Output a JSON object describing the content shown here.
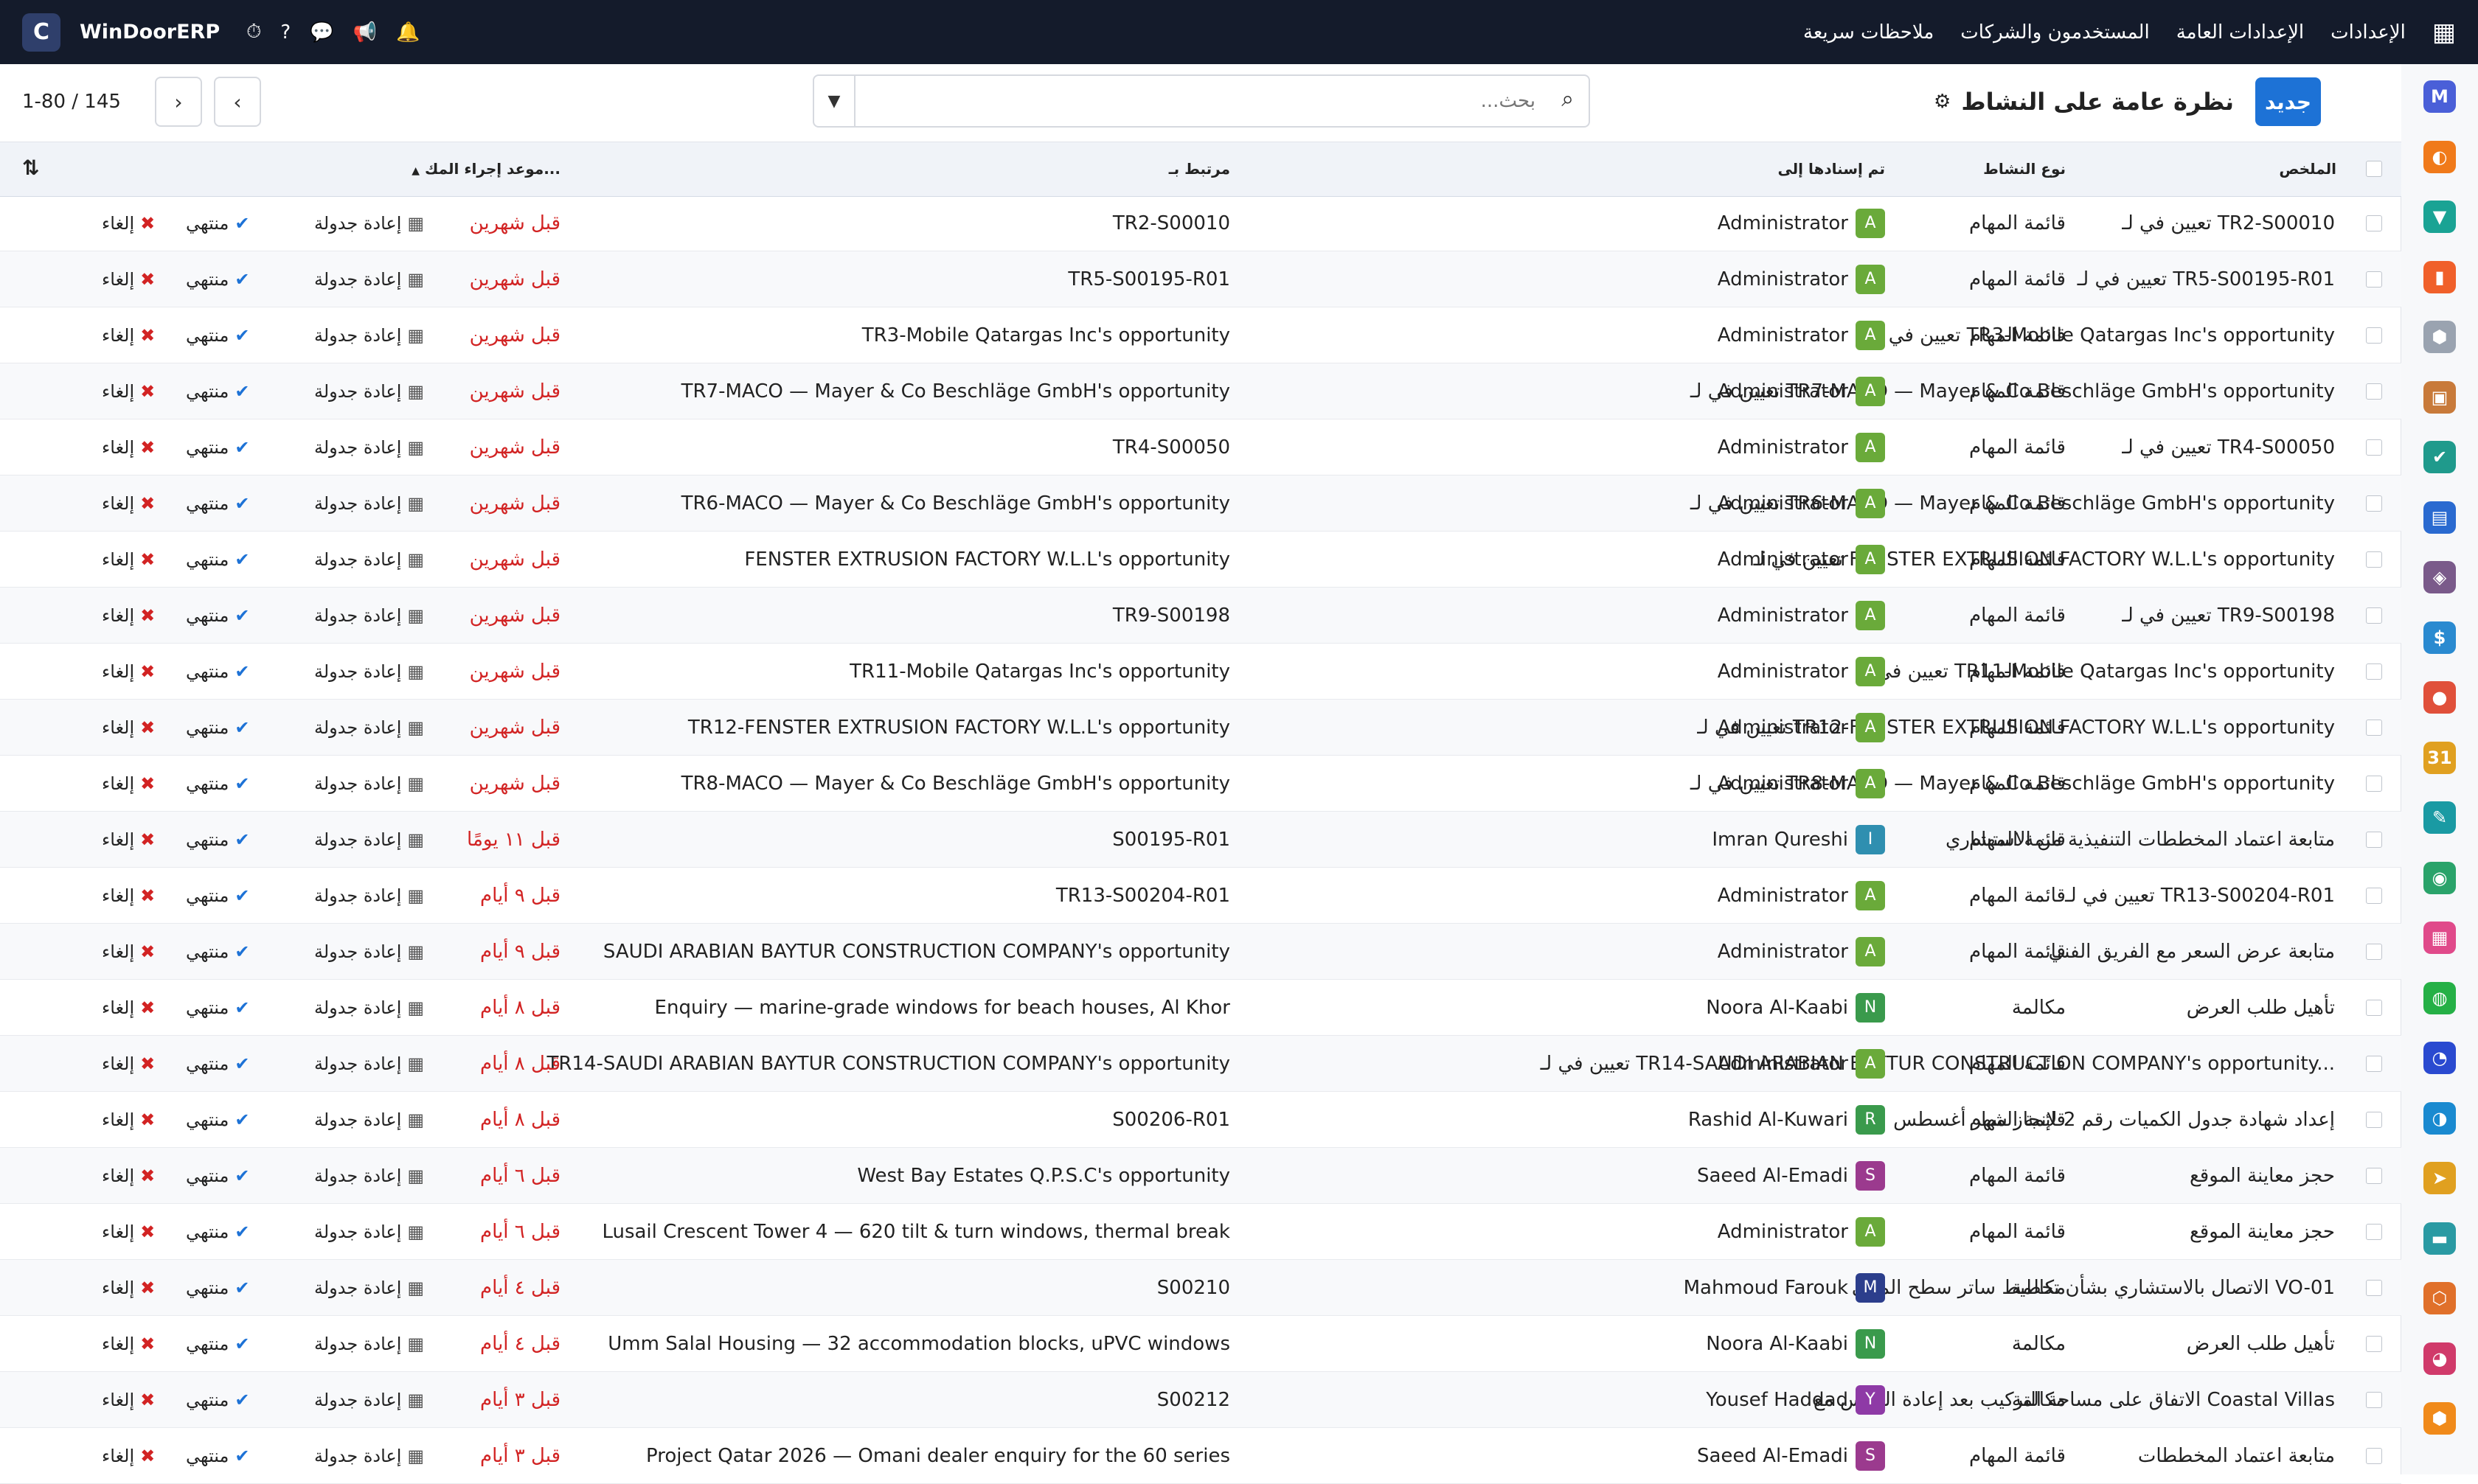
{
  "topbar": {
    "logo_letter": "C",
    "app_name": "WinDoorERP",
    "menus": [
      "الإعدادات",
      "الإعدادات العامة",
      "المستخدمون والشركات",
      "ملاحظات سريعة"
    ]
  },
  "control_panel": {
    "new_button": "جديد",
    "title": "نظرة عامة على النشاط",
    "search_placeholder": "بحث...",
    "pager": "1-80 / 145"
  },
  "table": {
    "headers": {
      "summary": "الملخص",
      "type": "نوع النشاط",
      "assigned": "تم إسنادها إلى",
      "related": "مرتبط بـ",
      "due": "موعد إجراء المك..."
    },
    "actions": {
      "reschedule": "إعادة جدولة",
      "done": "منتهي",
      "cancel": "إلغاء"
    },
    "rows": [
      {
        "summary": "تعيين في لـ TR2-S00010",
        "type": "قائمة المهام",
        "assignee": "Administrator",
        "initial": "A",
        "avatar_color": "#6aaa3a",
        "related": "TR2-S00010",
        "due": "قبل شهرين"
      },
      {
        "summary": "تعيين في لـ TR5-S00195-R01",
        "type": "قائمة المهام",
        "assignee": "Administrator",
        "initial": "A",
        "avatar_color": "#6aaa3a",
        "related": "TR5-S00195-R01",
        "due": "قبل شهرين"
      },
      {
        "summary": "تعيين في لـ TR3-Mobile Qatargas Inc's opportunity",
        "type": "قائمة المهام",
        "assignee": "Administrator",
        "initial": "A",
        "avatar_color": "#6aaa3a",
        "related": "TR3-Mobile Qatargas Inc's opportunity",
        "due": "قبل شهرين"
      },
      {
        "summary": "تعيين في لـ TR7-MACO — Mayer & Co Beschläge GmbH's opportunity",
        "type": "قائمة المهام",
        "assignee": "Administrator",
        "initial": "A",
        "avatar_color": "#6aaa3a",
        "related": "TR7-MACO — Mayer & Co Beschläge GmbH's opportunity",
        "due": "قبل شهرين"
      },
      {
        "summary": "تعيين في لـ TR4-S00050",
        "type": "قائمة المهام",
        "assignee": "Administrator",
        "initial": "A",
        "avatar_color": "#6aaa3a",
        "related": "TR4-S00050",
        "due": "قبل شهرين"
      },
      {
        "summary": "تعيين في لـ TR6-MACO — Mayer & Co Beschläge GmbH's opportunity",
        "type": "قائمة المهام",
        "assignee": "Administrator",
        "initial": "A",
        "avatar_color": "#6aaa3a",
        "related": "TR6-MACO — Mayer & Co Beschläge GmbH's opportunity",
        "due": "قبل شهرين"
      },
      {
        "summary": "تعيين في لـ FENSTER EXTRUSION FACTORY W.L.L's opportunity",
        "type": "قائمة المهام",
        "assignee": "Administrator",
        "initial": "A",
        "avatar_color": "#6aaa3a",
        "related": "FENSTER EXTRUSION FACTORY W.L.L's opportunity",
        "due": "قبل شهرين"
      },
      {
        "summary": "تعيين في لـ TR9-S00198",
        "type": "قائمة المهام",
        "assignee": "Administrator",
        "initial": "A",
        "avatar_color": "#6aaa3a",
        "related": "TR9-S00198",
        "due": "قبل شهرين"
      },
      {
        "summary": "تعيين في لـ TR11-Mobile Qatargas Inc's opportunity",
        "type": "قائمة المهام",
        "assignee": "Administrator",
        "initial": "A",
        "avatar_color": "#6aaa3a",
        "related": "TR11-Mobile Qatargas Inc's opportunity",
        "due": "قبل شهرين"
      },
      {
        "summary": "تعيين في لـ TR12-FENSTER EXTRUSION FACTORY W.L.L's opportunity",
        "type": "قائمة المهام",
        "assignee": "Administrator",
        "initial": "A",
        "avatar_color": "#6aaa3a",
        "related": "TR12-FENSTER EXTRUSION FACTORY W.L.L's opportunity",
        "due": "قبل شهرين"
      },
      {
        "summary": "تعيين في لـ TR8-MACO — Mayer & Co Beschläge GmbH's opportunity",
        "type": "قائمة المهام",
        "assignee": "Administrator",
        "initial": "A",
        "avatar_color": "#6aaa3a",
        "related": "TR8-MACO — Mayer & Co Beschläge GmbH's opportunity",
        "due": "قبل شهرين"
      },
      {
        "summary": "متابعة اعتماد المخططات التنفيذية من الاستشاري",
        "type": "قائمة المهام",
        "assignee": "Imran Qureshi",
        "initial": "I",
        "avatar_color": "#2f8fb0",
        "related": "S00195-R01",
        "due": "قبل ١١ يومًا"
      },
      {
        "summary": "تعيين في لـ TR13-S00204-R01",
        "type": "قائمة المهام",
        "assignee": "Administrator",
        "initial": "A",
        "avatar_color": "#6aaa3a",
        "related": "TR13-S00204-R01",
        "due": "قبل ٩ أيام"
      },
      {
        "summary": "متابعة عرض السعر مع الفريق الفني",
        "type": "قائمة المهام",
        "assignee": "Administrator",
        "initial": "A",
        "avatar_color": "#6aaa3a",
        "related": "SAUDI ARABIAN BAYTUR CONSTRUCTION COMPANY's opportunity",
        "due": "قبل ٩ أيام"
      },
      {
        "summary": "تأهيل طلب العرض",
        "type": "مكالمة",
        "assignee": "Noora Al-Kaabi",
        "initial": "N",
        "avatar_color": "#3a9a4c",
        "related": "Enquiry — marine-grade windows for beach houses, Al Khor",
        "due": "قبل ٨ أيام"
      },
      {
        "summary": "تعيين في لـ TR14-SAUDI ARABIAN BAYTUR CONSTRUCTION COMPANY's opportunity...",
        "type": "قائمة المهام",
        "assignee": "Administrator",
        "initial": "A",
        "avatar_color": "#6aaa3a",
        "related": "TR14-SAUDI ARABIAN BAYTUR CONSTRUCTION COMPANY's opportunity",
        "due": "قبل ٨ أيام"
      },
      {
        "summary": "إعداد شهادة جدول الكميات رقم 2 لإنجاز شهر أغسطس",
        "type": "قائمة المهام",
        "assignee": "Rashid Al-Kuwari",
        "initial": "R",
        "avatar_color": "#3a9a4c",
        "related": "S00206-R01",
        "due": "قبل ٨ أيام"
      },
      {
        "summary": "حجز معاينة الموقع",
        "type": "قائمة المهام",
        "assignee": "Saeed Al-Emadi",
        "initial": "S",
        "avatar_color": "#9b3a8e",
        "related": "West Bay Estates Q.P.S.C's opportunity",
        "due": "قبل ٦ أيام"
      },
      {
        "summary": "حجز معاينة الموقع",
        "type": "قائمة المهام",
        "assignee": "Administrator",
        "initial": "A",
        "avatar_color": "#6aaa3a",
        "related": "Lusail Crescent Tower 4 — 620 tilt & turn windows, thermal break",
        "due": "قبل ٦ أيام"
      },
      {
        "summary": "الاتصال بالاستشاري بشأن تخطيط ساتر سطح المبنى VO-01",
        "type": "مكالمة",
        "assignee": "Mahmoud Farouk",
        "initial": "M",
        "avatar_color": "#2c3e8c",
        "related": "S00210",
        "due": "قبل ٤ أيام"
      },
      {
        "summary": "تأهيل طلب العرض",
        "type": "مكالمة",
        "assignee": "Noora Al-Kaabi",
        "initial": "N",
        "avatar_color": "#3a9a4c",
        "related": "Umm Salal Housing — 32 accommodation blocks, uPVC windows",
        "due": "قبل ٤ أيام"
      },
      {
        "summary": "الاتفاق على مساحة التركيب بعد إعادة القياس مع Coastal Villas",
        "type": "مكالمة",
        "assignee": "Yousef Haddad",
        "initial": "Y",
        "avatar_color": "#8e3aa6",
        "related": "S00212",
        "due": "قبل ٣ أيام"
      },
      {
        "summary": "متابعة اعتماد المخططات",
        "type": "قائمة المهام",
        "assignee": "Saeed Al-Emadi",
        "initial": "S",
        "avatar_color": "#9b3a8e",
        "related": "Project Qatar 2026 — Omani dealer enquiry for the 60 series",
        "due": "قبل ٣ أيام"
      }
    ]
  },
  "rail_apps": [
    {
      "name": "discuss-app-icon",
      "letter": "M",
      "color": "#4a5fd8"
    },
    {
      "name": "crm-app-icon",
      "letter": "◐",
      "color": "#f07a1a"
    },
    {
      "name": "sales-app-icon",
      "letter": "▼",
      "color": "#1aa394"
    },
    {
      "name": "reporting-app-icon",
      "letter": "▮",
      "color": "#f0602a"
    },
    {
      "name": "inventory-app-icon",
      "letter": "⬢",
      "color": "#9aa3b0"
    },
    {
      "name": "contacts-app-icon",
      "letter": "▣",
      "color": "#c87a3a"
    },
    {
      "name": "project-app-icon",
      "letter": "✔",
      "color": "#1f9a8c"
    },
    {
      "name": "knowledge-app-icon",
      "letter": "▤",
      "color": "#2a6ad0"
    },
    {
      "name": "purchase-app-icon",
      "letter": "◈",
      "color": "#7a5a8a"
    },
    {
      "name": "invoicing-app-icon",
      "letter": "$",
      "color": "#2a8ad0"
    },
    {
      "name": "employees-app-icon",
      "letter": "●",
      "color": "#e0503a"
    },
    {
      "name": "calendar-app-icon",
      "letter": "31",
      "color": "#e0a020"
    },
    {
      "name": "sign-app-icon",
      "letter": "✎",
      "color": "#1a9aa3"
    },
    {
      "name": "appraisal-app-icon",
      "letter": "◉",
      "color": "#2aa36a"
    },
    {
      "name": "dashboards-app-icon",
      "letter": "▦",
      "color": "#e04a8a"
    },
    {
      "name": "whatsapp-app-icon",
      "letter": "◍",
      "color": "#25b046"
    },
    {
      "name": "timer-app-icon",
      "letter": "◔",
      "color": "#2a4ad0"
    },
    {
      "name": "helpdesk-app-icon",
      "letter": "◑",
      "color": "#1a8ad0"
    },
    {
      "name": "telegram-app-icon",
      "letter": "➤",
      "color": "#e0a020"
    },
    {
      "name": "approvals-app-icon",
      "letter": "▬",
      "color": "#2a9aa3"
    },
    {
      "name": "manufacturing-app-icon",
      "letter": "⬡",
      "color": "#e0702a"
    },
    {
      "name": "planning-app-icon",
      "letter": "◕",
      "color": "#d03a6a"
    },
    {
      "name": "repair-app-icon",
      "letter": "⬢",
      "color": "#f08a1a"
    }
  ]
}
